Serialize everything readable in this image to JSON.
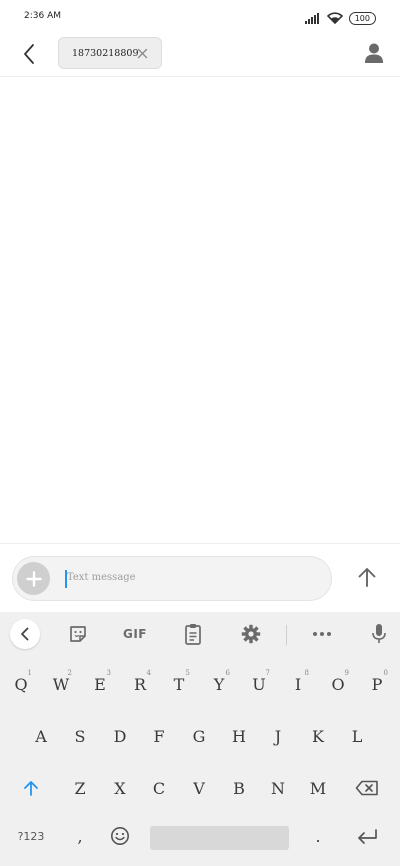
{
  "status_bar": {
    "time": "2:36 AM",
    "battery": "100"
  },
  "header": {
    "recipient": "18730218809"
  },
  "compose": {
    "placeholder": "Text message"
  },
  "keyboard": {
    "toolbar": {
      "gif_label": "GIF"
    },
    "row1": [
      {
        "key": "Q",
        "hint": "1"
      },
      {
        "key": "W",
        "hint": "2"
      },
      {
        "key": "E",
        "hint": "3"
      },
      {
        "key": "R",
        "hint": "4"
      },
      {
        "key": "T",
        "hint": "5"
      },
      {
        "key": "Y",
        "hint": "6"
      },
      {
        "key": "U",
        "hint": "7"
      },
      {
        "key": "I",
        "hint": "8"
      },
      {
        "key": "O",
        "hint": "9"
      },
      {
        "key": "P",
        "hint": "0"
      }
    ],
    "row2": [
      "A",
      "S",
      "D",
      "F",
      "G",
      "H",
      "J",
      "K",
      "L"
    ],
    "row3": [
      "Z",
      "X",
      "C",
      "V",
      "B",
      "N",
      "M"
    ],
    "row4": {
      "symbols_label": "?123",
      "comma": ",",
      "period": "."
    }
  }
}
